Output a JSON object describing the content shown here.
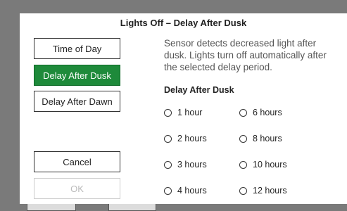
{
  "dialog": {
    "title": "Lights Off – Delay After Dusk",
    "modes": [
      {
        "label": "Time of Day",
        "selected": false
      },
      {
        "label": "Delay After Dusk",
        "selected": true
      },
      {
        "label": "Delay After Dawn",
        "selected": false
      }
    ],
    "cancel_label": "Cancel",
    "ok_label": "OK",
    "description": "Sensor detects decreased light after dusk. Lights turn off automatically after the selected delay period.",
    "section_label": "Delay After Dusk",
    "options": [
      {
        "label": "1 hour",
        "checked": false
      },
      {
        "label": "6 hours",
        "checked": false
      },
      {
        "label": "2 hours",
        "checked": false
      },
      {
        "label": "8 hours",
        "checked": false
      },
      {
        "label": "3 hours",
        "checked": false
      },
      {
        "label": "10 hours",
        "checked": false
      },
      {
        "label": "4 hours",
        "checked": false
      },
      {
        "label": "12 hours",
        "checked": false
      }
    ]
  },
  "colors": {
    "accent": "#1e8a3a",
    "overlay": "#7a7a7a"
  }
}
